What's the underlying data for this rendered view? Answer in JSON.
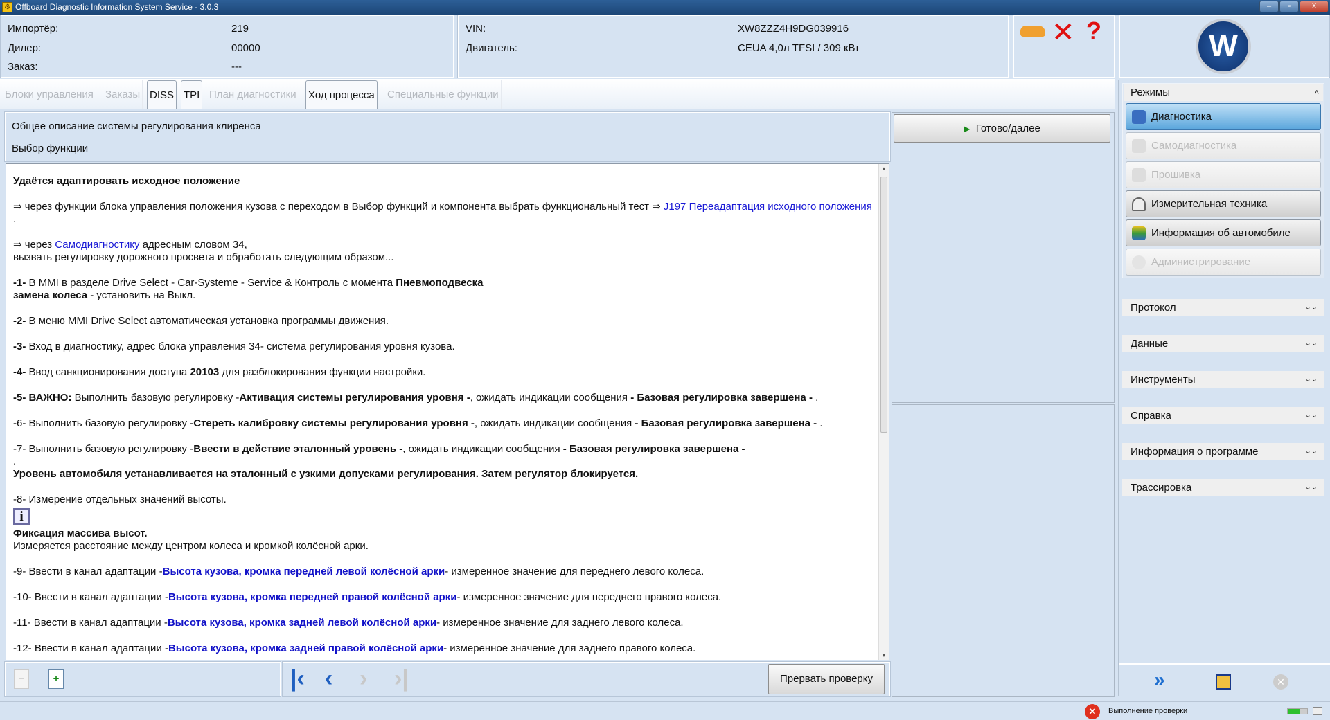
{
  "window": {
    "title": "Offboard Diagnostic Information System Service - 3.0.3",
    "app_icon": "odis-icon",
    "controls": [
      "–",
      "▫",
      "X"
    ]
  },
  "header": {
    "importer_label": "Импортёр:",
    "importer": "219",
    "dealer_label": "Дилер:",
    "dealer": "00000",
    "order_label": "Заказ:",
    "order": "---",
    "vin_label": "VIN:",
    "vin": "XW8ZZZ4H9DG039916",
    "engine_label": "Двигатель:",
    "engine": "CEUA 4,0л TFSI / 309 кВт",
    "status_icons": [
      "car-icon",
      "network-disconnected-icon",
      "help-icon"
    ]
  },
  "tabs": [
    {
      "label": "Блоки управления",
      "state": "disabled"
    },
    {
      "label": "Заказы",
      "state": "disabled"
    },
    {
      "label": "DISS",
      "state": "enabled"
    },
    {
      "label": "TPI",
      "state": "enabled"
    },
    {
      "label": "План диагностики",
      "state": "disabled"
    },
    {
      "label": "Ход процесса",
      "state": "active"
    },
    {
      "label": "Специальные функции",
      "state": "disabled"
    }
  ],
  "process": {
    "title": "Общее описание системы регулирования клиренса",
    "subtitle": "Выбор функции",
    "next_button": "Готово/далее",
    "abort_button": "Прервать проверку"
  },
  "document": [
    [
      [
        "b",
        "Удаётся адаптировать исходное положение"
      ]
    ],
    [
      [
        "n",
        "⇒ через функции блока управления положения кузова с переходом в Выбор функций и компонента выбрать функциональный тест ⇒ "
      ],
      [
        "lk",
        "J197 Переадаптация исходного положения"
      ],
      [
        "n",
        " ."
      ]
    ],
    [
      [
        "n",
        "⇒ через "
      ],
      [
        "lk",
        "Самодиагностику"
      ],
      [
        "n",
        " адресным словом 34,"
      ],
      [
        "br",
        ""
      ],
      [
        "n",
        "вызвать регулировку дорожного просвета и обработать следующим образом..."
      ]
    ],
    [
      [
        "b",
        "-1- "
      ],
      [
        "n",
        "В MMI в разделе Drive Select - Car-Systeme - Service & Контроль с момента "
      ],
      [
        "b",
        "Пневмоподвеска"
      ],
      [
        "br",
        ""
      ],
      [
        "b",
        "замена колеса"
      ],
      [
        "n",
        " - установить на Выкл."
      ]
    ],
    [
      [
        "b",
        "-2- "
      ],
      [
        "n",
        "В меню MMI Drive Select  автоматическая установка программы движения."
      ]
    ],
    [
      [
        "b",
        "-3- "
      ],
      [
        "n",
        "Вход в диагностику, адрес блока управления 34- система регулирования уровня кузова."
      ]
    ],
    [
      [
        "b",
        "-4- "
      ],
      [
        "n",
        "Ввод санкционирования доступа "
      ],
      [
        "b",
        "20103"
      ],
      [
        "n",
        " для разблокирования функции настройки."
      ]
    ],
    [
      [
        "b",
        "-5- ВАЖНО: "
      ],
      [
        "n",
        "Выполнить базовую регулировку -"
      ],
      [
        "b",
        "Активация системы регулирования уровня -"
      ],
      [
        "n",
        ", ожидать индикации сообщения "
      ],
      [
        "b",
        "- Базовая регулировка завершена -"
      ],
      [
        "n",
        " ."
      ]
    ],
    [
      [
        "n",
        "-6- Выполнить базовую регулировку -"
      ],
      [
        "b",
        "Стереть калибровку системы регулирования уровня -"
      ],
      [
        "n",
        ", ожидать индикации сообщения "
      ],
      [
        "b",
        "- Базовая регулировка завершена -"
      ],
      [
        "n",
        " ."
      ]
    ],
    [
      [
        "n",
        "-7- Выполнить базовую регулировку -"
      ],
      [
        "b",
        "Ввести в действие эталонный уровень -"
      ],
      [
        "n",
        ", ожидать индикации сообщения "
      ],
      [
        "b",
        "- Базовая регулировка завершена -"
      ],
      [
        "br",
        ""
      ],
      [
        "n",
        "."
      ],
      [
        "br",
        ""
      ],
      [
        "b",
        "Уровень автомобиля устанавливается на эталонный с узкими допусками регулирования. Затем регулятор блокируется."
      ]
    ],
    [
      [
        "n",
        "-8- Измерение отдельных значений высоты."
      ],
      [
        "info",
        "i"
      ],
      [
        "b",
        "Фиксация массива высот."
      ],
      [
        "br",
        ""
      ],
      [
        "n",
        "Измеряется расстояние между центром колеса и кромкой колёсной арки."
      ]
    ],
    [
      [
        "n",
        "-9- Ввести в канал адаптации -"
      ],
      [
        "bl",
        "Высота кузова, кромка передней левой колёсной арки"
      ],
      [
        "n",
        "- измеренное значение для переднего левого колеса."
      ]
    ],
    [
      [
        "n",
        "-10- Ввести в канал адаптации -"
      ],
      [
        "bl",
        "Высота кузова, кромка передней правой колёсной арки"
      ],
      [
        "n",
        "- измеренное значение для переднего правого колеса."
      ]
    ],
    [
      [
        "n",
        "-11- Ввести в канал адаптации -"
      ],
      [
        "bl",
        "Высота кузова, кромка задней левой колёсной арки"
      ],
      [
        "n",
        "- измеренное значение для заднего левого колеса."
      ]
    ],
    [
      [
        "n",
        "-12- Ввести в канал адаптации -"
      ],
      [
        "bl",
        "Высота кузова, кромка задней правой колёсной арки"
      ],
      [
        "n",
        "- измеренное значение для заднего правого колеса."
      ]
    ]
  ],
  "sidebar": {
    "modes_title": "Режимы",
    "modes": [
      {
        "label": "Диагностика",
        "state": "active",
        "icon": "stethoscope-icon"
      },
      {
        "label": "Самодиагностика",
        "state": "disabled",
        "icon": "self-diagnosis-icon"
      },
      {
        "label": "Прошивка",
        "state": "disabled",
        "icon": "flash-icon"
      },
      {
        "label": "Измерительная техника",
        "state": "enabled",
        "icon": "gauge-icon"
      },
      {
        "label": "Информация об автомобиле",
        "state": "enabled",
        "icon": "books-icon"
      },
      {
        "label": "Администрирование",
        "state": "disabled",
        "icon": "admin-gear-icon"
      }
    ],
    "sections": [
      "Протокол",
      "Данные",
      "Инструменты",
      "Справка",
      "Информация о программе",
      "Трассировка"
    ]
  },
  "status": {
    "text": "Выполнение проверки",
    "progress": 0.6
  }
}
